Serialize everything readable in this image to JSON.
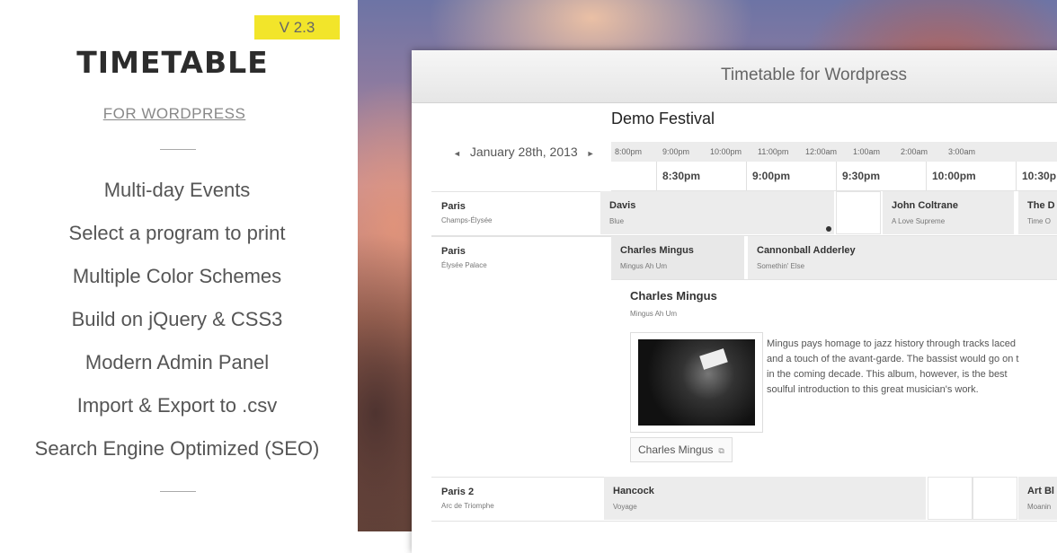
{
  "promo": {
    "version": "V 2.3",
    "title": "TIMETABLE",
    "subtitle": "FOR WORDPRESS",
    "features": [
      "Multi-day Events",
      "Select a program to print",
      "Multiple Color Schemes",
      "Build on jQuery & CSS3",
      "Modern Admin Panel",
      "Import & Export to .csv",
      "Search Engine Optimized (SEO)"
    ]
  },
  "window": {
    "title": "Timetable for Wordpress",
    "festival": "Demo Festival",
    "date": "January 28th, 2013",
    "nav_prev_icon": "◄",
    "nav_next_icon": "►",
    "overview_hours": [
      "8:00pm",
      "9:00pm",
      "10:00pm",
      "11:00pm",
      "12:00am",
      "1:00am",
      "2:00am",
      "3:00am"
    ],
    "ticks": [
      "8:30pm",
      "9:00pm",
      "9:30pm",
      "10:00pm",
      "10:30p"
    ],
    "rows": [
      {
        "city": "Paris",
        "venue": "Champs-Élysée"
      },
      {
        "city": "Paris",
        "venue": "Élysée Palace"
      },
      {
        "city": "Paris 2",
        "venue": "Arc de Triomphe"
      }
    ],
    "events": {
      "r1_a": {
        "title": "Davis",
        "sub": "Blue"
      },
      "r1_b": {
        "title": "John Coltrane",
        "sub": "A Love Supreme"
      },
      "r1_c": {
        "title": "The D",
        "sub": "Time O"
      },
      "r2_a": {
        "title": "Charles Mingus",
        "sub": "Mingus Ah Um"
      },
      "r2_b": {
        "title": "Cannonball Adderley",
        "sub": "Somethin' Else"
      },
      "r3_a": {
        "title": "Hancock",
        "sub": "Voyage"
      },
      "r3_b": {
        "title": "Art Bl",
        "sub": "Moanin"
      }
    },
    "detail": {
      "title": "Charles Mingus",
      "sub": "Mingus Ah Um",
      "description": [
        "Mingus pays homage to jazz history through tracks laced",
        "and a touch of the avant-garde. The bassist would go on t",
        "in the coming decade. This album, however, is the best",
        "soulful introduction to this great musician's work."
      ],
      "tag": "Charles Mingus",
      "tag_icon": "⧉"
    }
  }
}
